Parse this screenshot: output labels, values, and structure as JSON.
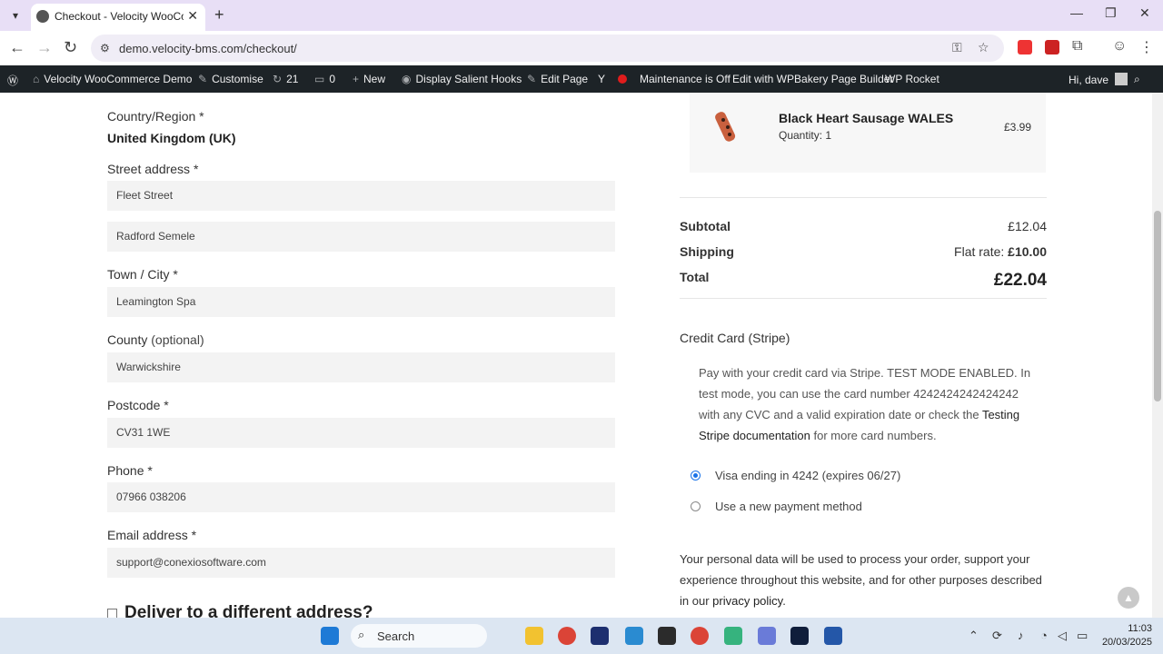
{
  "browser": {
    "tab_title": "Checkout - Velocity WooComm",
    "url": "demo.velocity-bms.com/checkout/"
  },
  "wpbar": {
    "site_name": "Velocity WooCommerce Demo",
    "customise": "Customise",
    "updates": "21",
    "comments": "0",
    "new": "New",
    "hooks": "Display Salient Hooks",
    "edit_page": "Edit Page",
    "maintenance": "Maintenance is Off",
    "wpbakery": "Edit with WPBakery Page Builder",
    "rocket": "WP Rocket",
    "greeting": "Hi, dave"
  },
  "billing": {
    "country_label": "Country/Region *",
    "country_value": "United Kingdom (UK)",
    "street_label": "Street address *",
    "street_1": "Fleet Street",
    "street_2": "Radford Semele",
    "city_label": "Town / City *",
    "city": "Leamington Spa",
    "county_label": "County",
    "county_optional": "(optional)",
    "county": "Warwickshire",
    "postcode_label": "Postcode *",
    "postcode": "CV31 1WE",
    "phone_label": "Phone *",
    "phone": "07966 038206",
    "email_label": "Email address *",
    "email": "support@conexiosoftware.com",
    "deliver_different": "Deliver to a different address?"
  },
  "order": {
    "product_name": "Black Heart Sausage WALES",
    "quantity": "Quantity: 1",
    "price": "£3.99",
    "subtotal_label": "Subtotal",
    "subtotal": "£12.04",
    "shipping_label": "Shipping",
    "shipping_method": "Flat rate:",
    "shipping_cost": "£10.00",
    "total_label": "Total",
    "total": "£22.04"
  },
  "payment": {
    "title": "Credit Card (Stripe)",
    "desc_1": "Pay with your credit card via Stripe. TEST MODE ENABLED. In test mode, you can use the card number 4242424242424242 with any CVC and a valid expiration date or check the",
    "desc_link": "Testing Stripe documentation",
    "desc_2": "for more card numbers.",
    "saved_card": "Visa ending in 4242 (expires 06/27)",
    "new_method": "Use a new payment method",
    "privacy_text": "Your personal data will be used to process your order, support your experience throughout this website, and for other purposes described in our",
    "privacy_link": "privacy policy",
    "privacy_end": "."
  },
  "taskbar": {
    "search": "Search",
    "time": "11:03",
    "date": "20/03/2025"
  },
  "colors": {
    "wpbar_bg": "#1d2327",
    "tabstrip_bg": "#e8dff6",
    "field_bg": "#f3f3f3",
    "radio_accent": "#1a73e8"
  }
}
